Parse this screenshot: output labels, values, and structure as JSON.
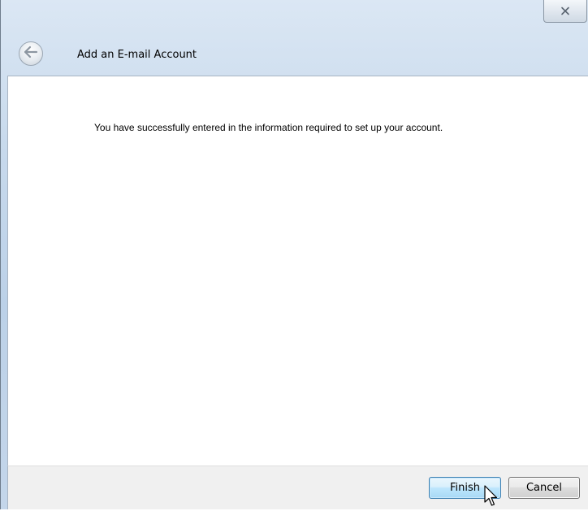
{
  "window": {
    "title": "Add an E-mail Account"
  },
  "icons": {
    "close": "close-icon",
    "back": "back-arrow-icon",
    "cursor": "mouse-pointer-icon"
  },
  "content": {
    "message": "You have successfully entered in the information required to set up your account."
  },
  "footer": {
    "finish_label": "Finish",
    "cancel_label": "Cancel"
  },
  "colors": {
    "header_gradient_top": "#dbe7f4",
    "header_gradient_bottom": "#c4d6ea",
    "finish_border": "#3c7fb1",
    "footer_bg": "#f0f0f0"
  }
}
